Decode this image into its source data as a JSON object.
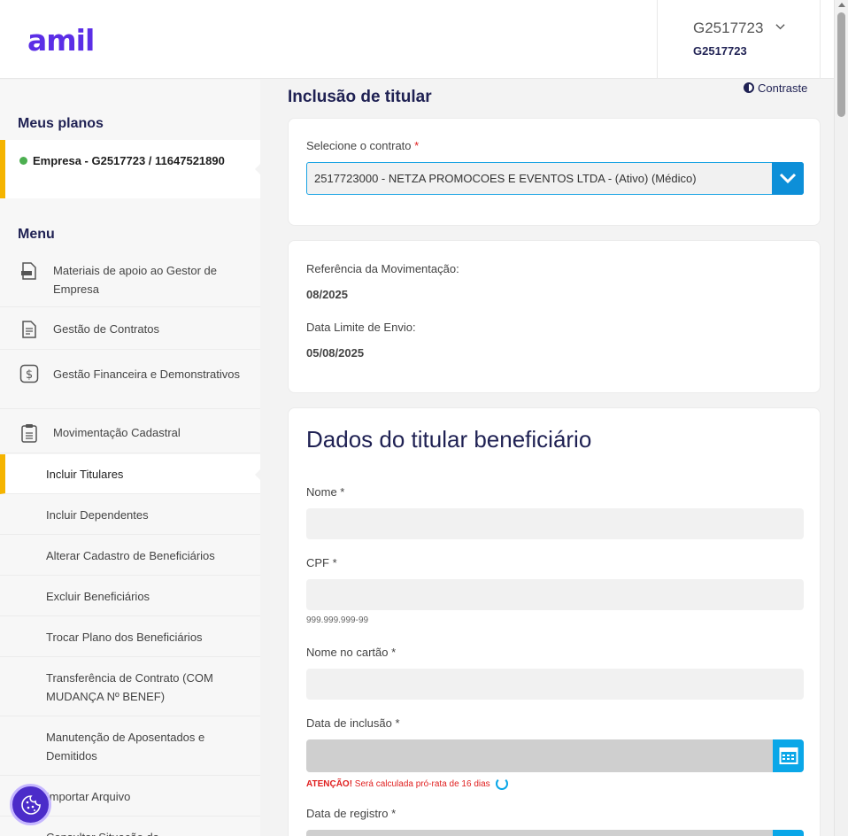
{
  "header": {
    "logo": "amil",
    "account_id": "G2517723",
    "account_sub": "G2517723"
  },
  "sidebar": {
    "plans_title": "Meus planos",
    "plan_card": "Empresa - G2517723 / 11647521890",
    "menu_title": "Menu",
    "items": [
      {
        "label": "Materiais de apoio ao Gestor de Empresa",
        "icon": "document-pdf-icon"
      },
      {
        "label": "Gestão de Contratos",
        "icon": "document-icon"
      },
      {
        "label": "Gestão Financeira e Demonstrativos",
        "icon": "dollar-icon"
      },
      {
        "label": "Movimentação Cadastral",
        "icon": "clipboard-icon"
      }
    ],
    "sub_items": [
      {
        "label": "Incluir Titulares",
        "active": true
      },
      {
        "label": "Incluir Dependentes"
      },
      {
        "label": "Alterar Cadastro de Beneficiários"
      },
      {
        "label": "Excluir Beneficiários"
      },
      {
        "label": "Trocar Plano dos Beneficiários"
      },
      {
        "label": "Transferência de Contrato (COM MUDANÇA Nº BENEF)"
      },
      {
        "label": "Manutenção de Aposentados e Demitidos"
      },
      {
        "label": "Importar Arquivo"
      },
      {
        "label": "Consultar Situação da"
      }
    ]
  },
  "main": {
    "title": "Inclusão de titular",
    "contrast_label": "Contraste",
    "contract": {
      "label": "Selecione o contrato",
      "required_mark": "*",
      "value": "2517723000 - NETZA PROMOCOES E EVENTOS LTDA - (Ativo) (Médico)"
    },
    "info": {
      "ref_label": "Referência da Movimentação:",
      "ref_value": "08/2025",
      "limit_label": "Data Limite de Envio:",
      "limit_value": "05/08/2025"
    },
    "form": {
      "title": "Dados do titular beneficiário",
      "name_label": "Nome *",
      "cpf_label": "CPF *",
      "cpf_hint": "999.999.999-99",
      "card_name_label": "Nome no cartão *",
      "inclusion_date_label": "Data de inclusão *",
      "warning_prefix": "ATENÇÃO!",
      "warning_text": " Será calculada pró-rata de 16 dias",
      "registry_date_label": "Data de registro *"
    }
  },
  "colors": {
    "brand": "#5b2ee6",
    "accent_yellow": "#f5b400",
    "primary_blue": "#0aa7e8",
    "navy": "#1f2153",
    "error": "#e02020"
  }
}
